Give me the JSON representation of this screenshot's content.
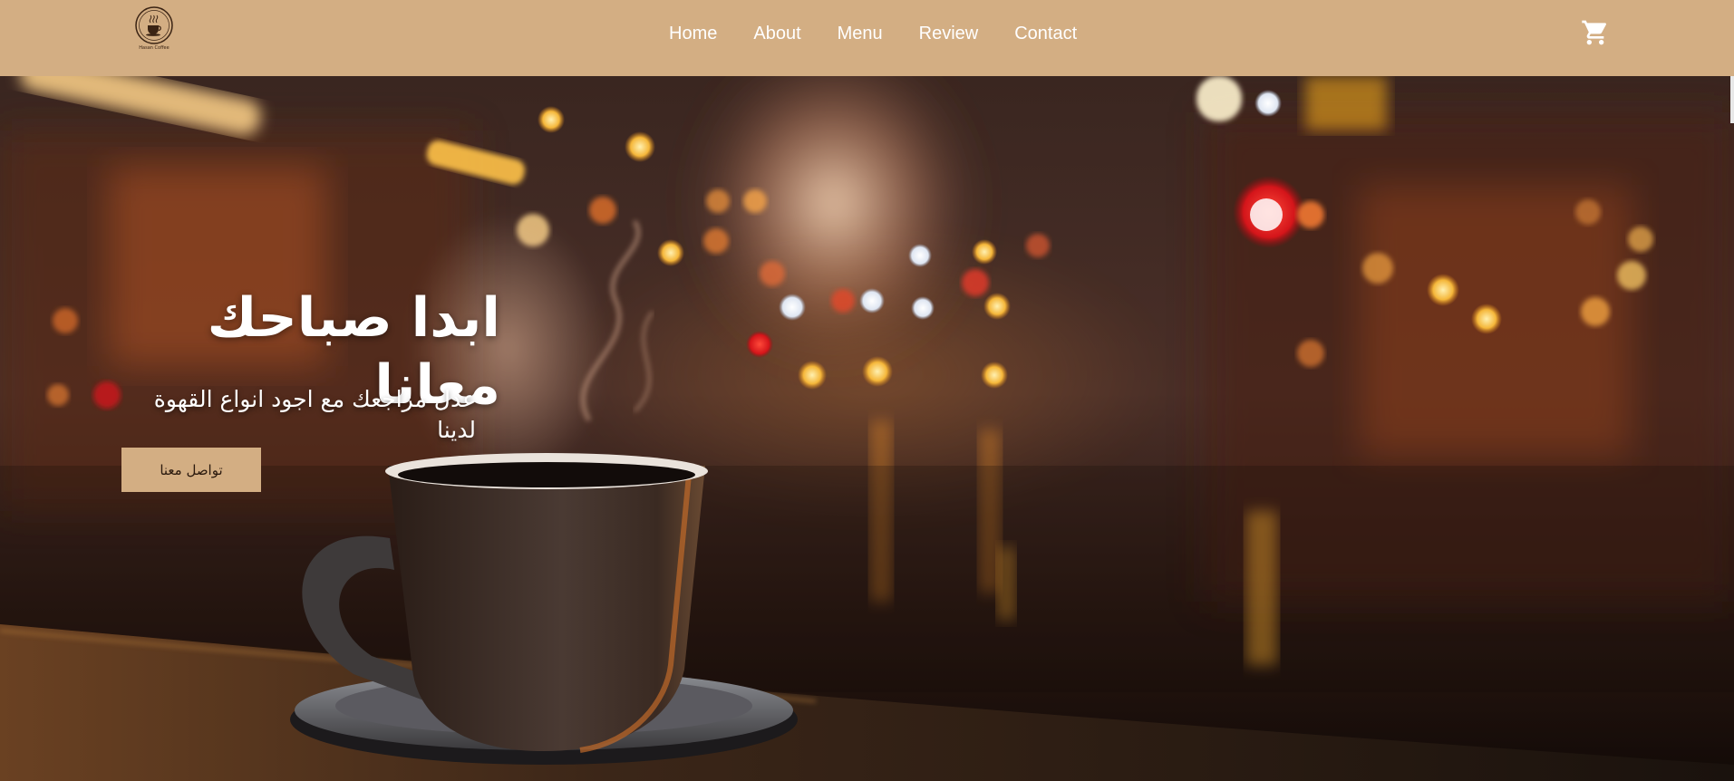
{
  "brand": {
    "logo_caption": "Hasan Coffee",
    "color": "#d3ae83"
  },
  "nav": {
    "items": [
      {
        "label": "Home"
      },
      {
        "label": "About"
      },
      {
        "label": "Menu"
      },
      {
        "label": "Review"
      },
      {
        "label": "Contact"
      }
    ],
    "cart_icon": "shopping-cart-icon"
  },
  "hero": {
    "title": "ابدا صباحك معانا",
    "subtitle": "عدل مزاجعك مع اجود انواع القهوة لدينا",
    "cta_label": "تواصل معنا",
    "background": "coffee-cup-city-night-bokeh"
  },
  "colors": {
    "nav_bg": "#d3ae83",
    "button_bg": "#d3ae83",
    "text_light": "#ffffff"
  }
}
